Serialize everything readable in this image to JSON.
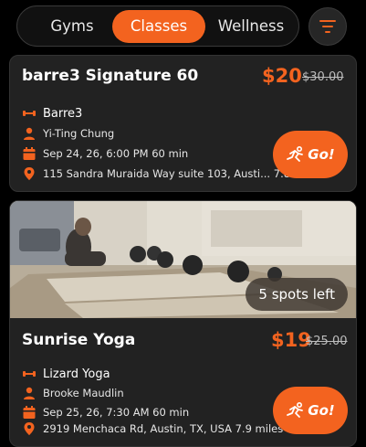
{
  "tabs": [
    {
      "label": "Gyms",
      "active": false
    },
    {
      "label": "Classes",
      "active": true
    },
    {
      "label": "Wellness",
      "active": false
    }
  ],
  "filter": {
    "icon": "filter-icon"
  },
  "colors": {
    "accent": "#f3631f",
    "card": "#222222",
    "background": "#000000"
  },
  "classes": [
    {
      "title": "barre3 Signature 60",
      "price": "$20",
      "original_price": "$30.00",
      "studio": "Barre3",
      "instructor": "Yi-Ting Chung",
      "schedule": "Sep 24, 26, 6:00 PM 60 min",
      "location": "115 Sandra Muraida Way suite 103, Austi... 7.8 miles",
      "go_label": "Go!"
    },
    {
      "title": "Sunrise Yoga",
      "price": "$19",
      "original_price": "$25.00",
      "spots": "5 spots left",
      "studio": "Lizard Yoga",
      "instructor": "Brooke Maudlin",
      "schedule": "Sep 25, 26, 7:30 AM 60 min",
      "location": "2919 Menchaca Rd, Austin, TX, USA 7.9 miles",
      "go_label": "Go!"
    }
  ]
}
